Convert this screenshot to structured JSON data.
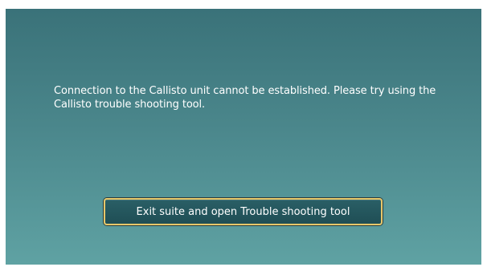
{
  "dialog": {
    "message": "Connection to the Callisto unit cannot be established. Please try using the Callisto trouble shooting tool.",
    "action_button_label": "Exit suite and open Trouble shooting tool"
  },
  "colors": {
    "panel_top": "#3a7279",
    "panel_bottom": "#5fa2a3",
    "button_border": "#e7c76a",
    "button_fill": "#1f4e55",
    "text": "#ffffff"
  }
}
